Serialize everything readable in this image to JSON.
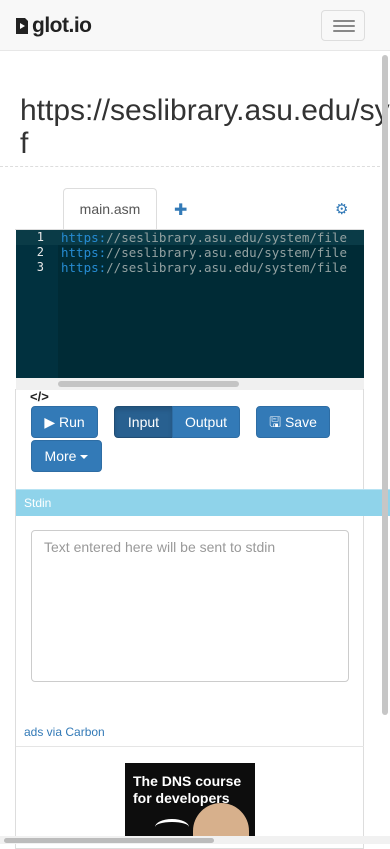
{
  "navbar": {
    "brand": "glot.io",
    "toggle_icon": "hamburger-menu-icon"
  },
  "page": {
    "title_line1": "https://seslibrary.asu.edu/sy",
    "title_line2": "f"
  },
  "tabs": {
    "code_icon": "</>",
    "file_tab": "main.asm",
    "add_icon": "plus-icon",
    "settings_icon": "gear-icon"
  },
  "editor": {
    "lines": [
      {
        "number": "1",
        "proto": "https:",
        "rest": "//seslibrary.asu.edu/system/file"
      },
      {
        "number": "2",
        "proto": "https:",
        "rest": "//seslibrary.asu.edu/system/file"
      },
      {
        "number": "3",
        "proto": "https:",
        "rest": "//seslibrary.asu.edu/system/file"
      }
    ],
    "colors": {
      "background": "#002b36",
      "protocol": "#268bd2"
    }
  },
  "toolbar": {
    "run_label": "Run",
    "input_label": "Input",
    "output_label": "Output",
    "save_label": "Save",
    "more_label": "More"
  },
  "stdin": {
    "header": "Stdin",
    "placeholder": "Text entered here will be sent to stdin"
  },
  "ads": {
    "link_text": "ads via Carbon",
    "ad_text_line1": "The DNS course",
    "ad_text_line2": "for developers"
  },
  "colors": {
    "accent": "#337ab7",
    "stdin_bar": "#8fd3ea"
  }
}
